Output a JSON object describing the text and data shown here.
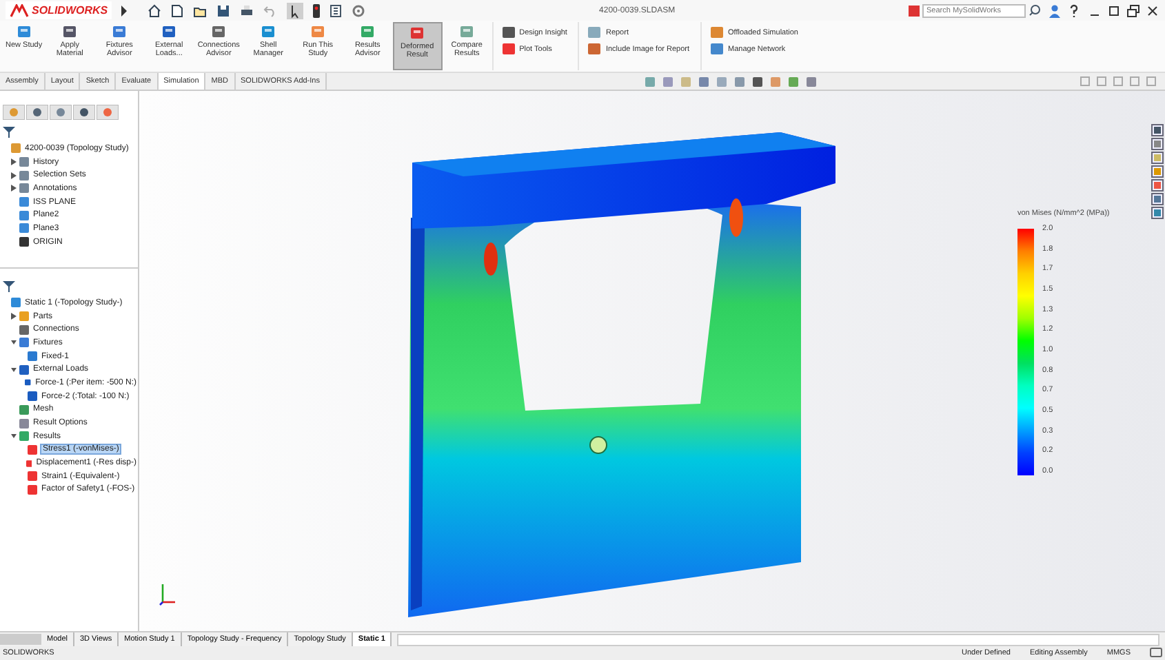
{
  "title_bar": {
    "app": "SOLIDWORKS",
    "document": "4200-0039.SLDASM",
    "search": {
      "placeholder": "Search MySolidWorks"
    }
  },
  "ribbon": {
    "buttons": [
      {
        "label": "New Study",
        "kind": "study",
        "selected": false
      },
      {
        "label": "Apply Material",
        "kind": "material",
        "selected": false
      },
      {
        "label": "Fixtures Advisor",
        "kind": "fixture",
        "selected": false
      },
      {
        "label": "External Loads...",
        "kind": "loads",
        "selected": false
      },
      {
        "label": "Connections Advisor",
        "kind": "connections",
        "selected": false
      },
      {
        "label": "Shell Manager",
        "kind": "shell",
        "selected": false
      },
      {
        "label": "Run This Study",
        "kind": "run",
        "selected": false
      },
      {
        "label": "Results Advisor",
        "kind": "results",
        "selected": false
      },
      {
        "label": "Deformed Result",
        "kind": "deformed",
        "selected": true
      },
      {
        "label": "Compare Results",
        "kind": "compare",
        "selected": false
      }
    ],
    "groups": [
      [
        {
          "label": "Design Insight",
          "kind": "insight"
        },
        {
          "label": "Plot Tools",
          "kind": "plot"
        }
      ],
      [
        {
          "label": "Report",
          "kind": "report"
        },
        {
          "label": "Include Image for Report",
          "kind": "image"
        }
      ],
      [
        {
          "label": "Offloaded Simulation",
          "kind": "offload"
        },
        {
          "label": "Manage Network",
          "kind": "network"
        }
      ]
    ]
  },
  "command_tabs": [
    {
      "label": "Assembly",
      "selected": false
    },
    {
      "label": "Layout",
      "selected": false
    },
    {
      "label": "Sketch",
      "selected": false
    },
    {
      "label": "Evaluate",
      "selected": false
    },
    {
      "label": "Simulation",
      "selected": true
    },
    {
      "label": "MBD",
      "selected": false
    },
    {
      "label": "SOLIDWORKS Add-Ins",
      "selected": false
    }
  ],
  "feature_tree": {
    "items": [
      {
        "label": "4200-0039 (Topology Study)",
        "kind": "assembly",
        "selected": false,
        "children": [
          {
            "label": "History",
            "kind": "folder",
            "expanded": false,
            "selected": false
          },
          {
            "label": "Selection Sets",
            "kind": "folder",
            "expanded": false,
            "selected": false
          },
          {
            "label": "Annotations",
            "kind": "folder",
            "expanded": false,
            "selected": false
          },
          {
            "label": "ISS PLANE",
            "kind": "plane",
            "selected": false
          },
          {
            "label": "Plane2",
            "kind": "plane",
            "selected": false
          },
          {
            "label": "Plane3",
            "kind": "plane",
            "selected": false
          },
          {
            "label": "ORIGIN",
            "kind": "origin",
            "selected": false
          }
        ]
      }
    ]
  },
  "simulation_tree": {
    "items": [
      {
        "label": "Static 1 (-Topology Study-)",
        "kind": "study",
        "selected": false,
        "children": [
          {
            "label": "Parts",
            "kind": "parts",
            "expanded": false,
            "selected": false
          },
          {
            "label": "Connections",
            "kind": "connections",
            "selected": false
          },
          {
            "label": "Fixtures",
            "kind": "fixture",
            "expanded": true,
            "selected": false,
            "children": [
              {
                "label": "Fixed-1",
                "kind": "fixed",
                "selected": false
              }
            ]
          },
          {
            "label": "External Loads",
            "kind": "loads",
            "expanded": true,
            "selected": false,
            "children": [
              {
                "label": "Force-1 (:Per item: -500 N:)",
                "kind": "force",
                "selected": false
              },
              {
                "label": "Force-2 (:Total: -100 N:)",
                "kind": "force",
                "selected": false
              }
            ]
          },
          {
            "label": "Mesh",
            "kind": "mesh",
            "selected": false
          },
          {
            "label": "Result Options",
            "kind": "options",
            "selected": false
          },
          {
            "label": "Results",
            "kind": "results",
            "expanded": true,
            "selected": false,
            "children": [
              {
                "label": "Stress1 (-vonMises-)",
                "kind": "plot",
                "selected": true
              },
              {
                "label": "Displacement1 (-Res disp-)",
                "kind": "plot",
                "selected": false
              },
              {
                "label": "Strain1 (-Equivalent-)",
                "kind": "plot",
                "selected": false
              },
              {
                "label": "Factor of Safety1 (-FOS-)",
                "kind": "plot",
                "selected": false
              }
            ]
          }
        ]
      }
    ]
  },
  "legend": {
    "title": "von Mises (N/mm^2 (MPa))",
    "labels": [
      "2.0",
      "1.8",
      "1.7",
      "1.5",
      "1.3",
      "1.2",
      "1.0",
      "0.8",
      "0.7",
      "0.5",
      "0.3",
      "0.2",
      "0.0"
    ]
  },
  "bottom_tabs": [
    {
      "label": "Model",
      "selected": false
    },
    {
      "label": "3D Views",
      "selected": false
    },
    {
      "label": "Motion Study 1",
      "selected": false
    },
    {
      "label": "Topology Study - Frequency",
      "selected": false
    },
    {
      "label": "Topology Study",
      "selected": false
    },
    {
      "label": "Static 1",
      "selected": true
    }
  ],
  "status_bar": {
    "app": "SOLIDWORKS",
    "items": [
      "Under Defined",
      "Editing Assembly",
      "MMGS"
    ]
  }
}
